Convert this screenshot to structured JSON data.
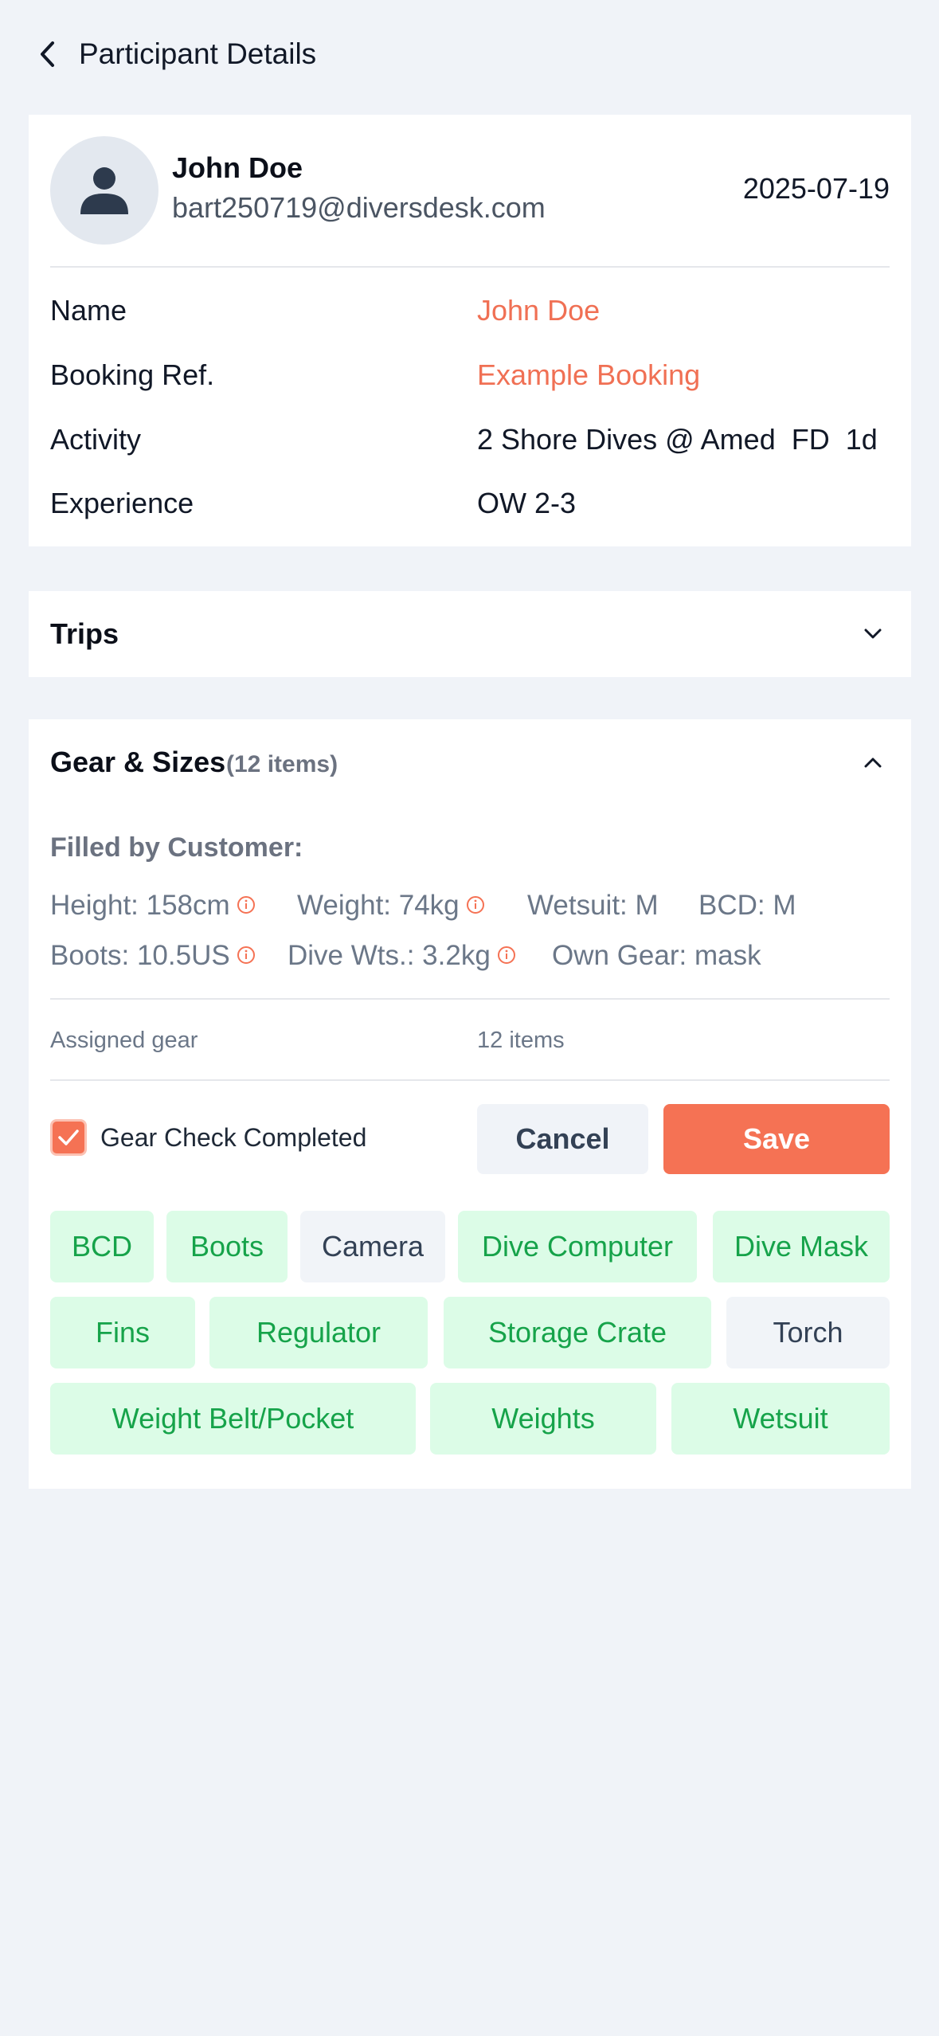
{
  "header": {
    "title": "Participant Details"
  },
  "participant": {
    "name": "John Doe",
    "email": "bart250719@diversdesk.com",
    "date": "2025-07-19",
    "fields": [
      {
        "label": "Name",
        "value": "John Doe"
      },
      {
        "label": "Booking Ref.",
        "value": "Example Booking"
      },
      {
        "label": "Activity",
        "value": "2 Shore Dives @ Amed  FD  1d"
      },
      {
        "label": "Experience",
        "value": "OW 2-3"
      }
    ]
  },
  "trips": {
    "title": "Trips",
    "expanded": false
  },
  "gear": {
    "title": "Gear & Sizes",
    "count_label": "(12 items)",
    "expanded": true,
    "filled_title": "Filled by Customer:",
    "measurements": [
      {
        "text": "Height: 158cm",
        "warning": true
      },
      {
        "text": "Weight: 74kg",
        "warning": true
      },
      {
        "text": "Wetsuit: M",
        "warning": false
      },
      {
        "text": "BCD: M",
        "warning": false
      },
      {
        "text": "Boots: 10.5US",
        "warning": true
      },
      {
        "text": "Dive Wts.: 3.2kg",
        "warning": true
      },
      {
        "text": "Own Gear: mask",
        "warning": false
      }
    ],
    "assigned_label": "Assigned gear",
    "assigned_count": "12 items",
    "check_label": "Gear Check Completed",
    "check_completed": true,
    "cancel_label": "Cancel",
    "save_label": "Save",
    "items": [
      {
        "label": "BCD",
        "assigned": true
      },
      {
        "label": "Boots",
        "assigned": true
      },
      {
        "label": "Camera",
        "assigned": false
      },
      {
        "label": "Dive Computer",
        "assigned": true
      },
      {
        "label": "Dive Mask",
        "assigned": true
      },
      {
        "label": "Fins",
        "assigned": true
      },
      {
        "label": "Regulator",
        "assigned": true
      },
      {
        "label": "Storage Crate",
        "assigned": true
      },
      {
        "label": "Torch",
        "assigned": false
      },
      {
        "label": "Weight Belt/Pocket",
        "assigned": true
      },
      {
        "label": "Weights",
        "assigned": true
      },
      {
        "label": "Wetsuit",
        "assigned": true
      }
    ]
  },
  "colors": {
    "accent": "#f57254",
    "link": "#f07054",
    "assigned_bg": "#dcfce7",
    "assigned_text": "#16a34a",
    "page_bg": "#f0f3f8"
  }
}
